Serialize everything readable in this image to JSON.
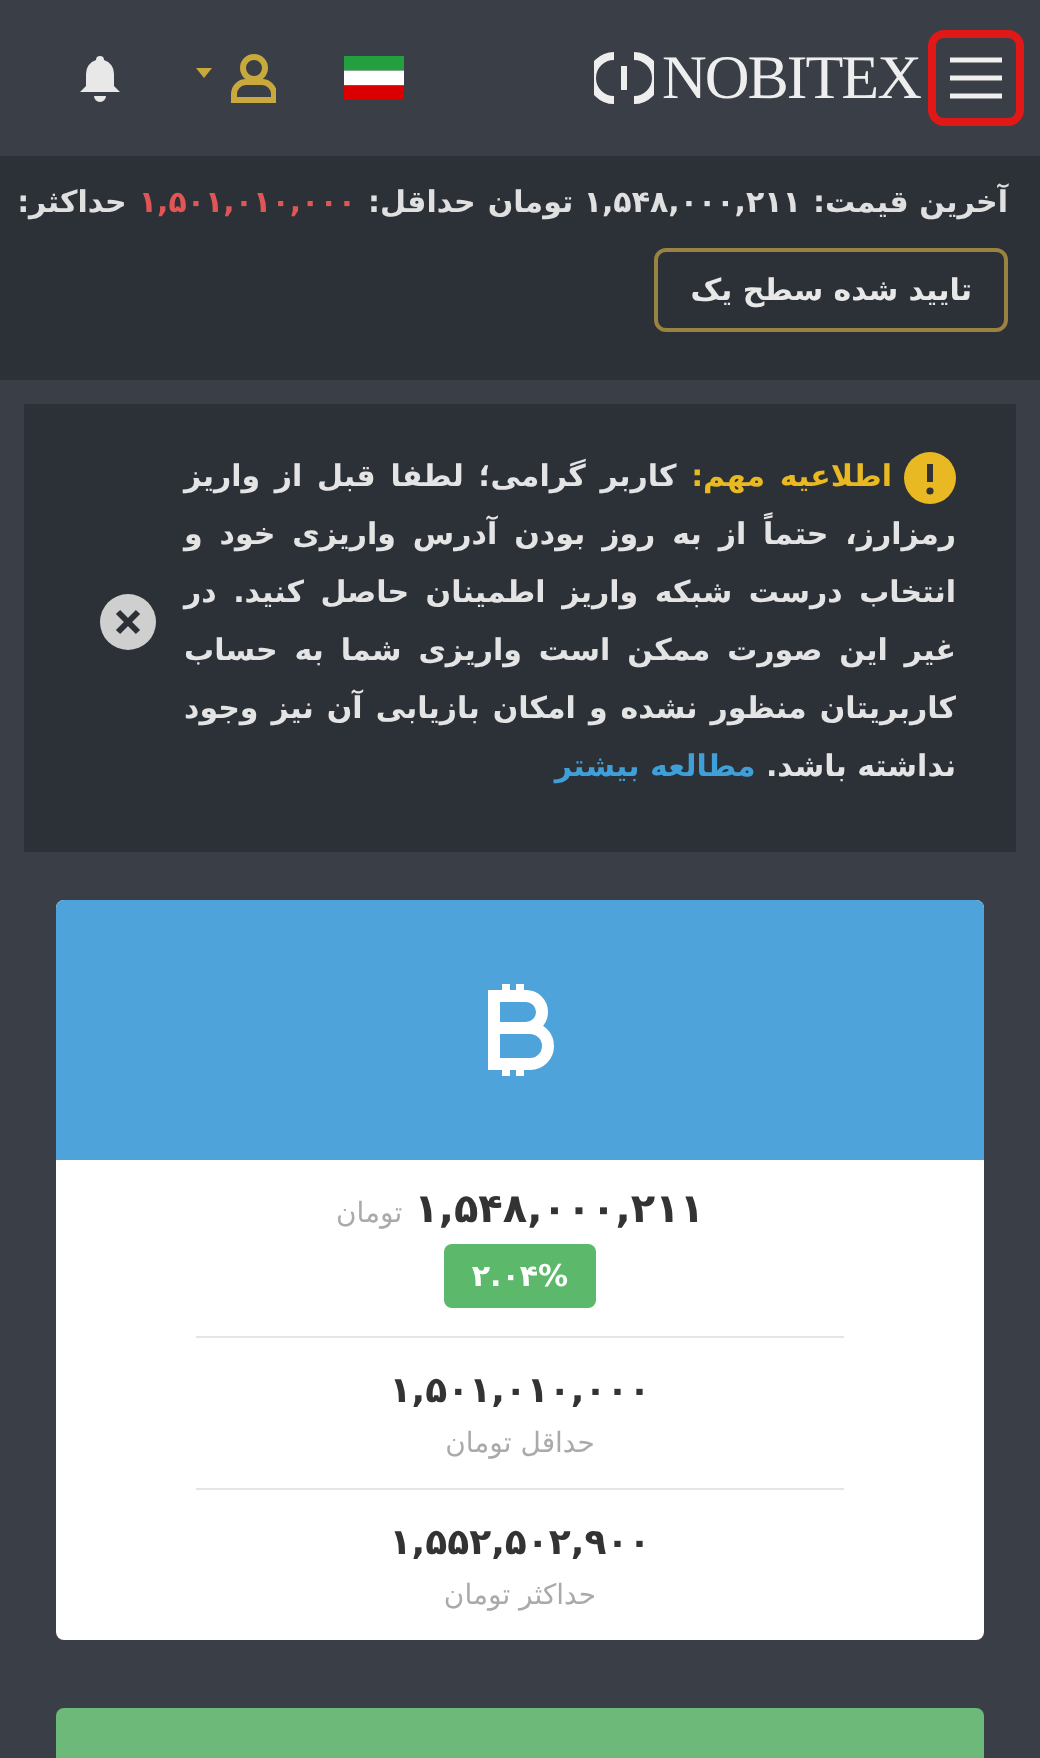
{
  "header": {
    "logo": "NOBITEX",
    "menu_highlighted": true
  },
  "ticker": {
    "items": [
      {
        "text": "آخرین قیمت:",
        "kind": "label"
      },
      {
        "text": "۱,۵۴۸,۰۰۰,۲۱۱ تومان",
        "kind": "value"
      },
      {
        "text": "حداقل:",
        "kind": "label"
      },
      {
        "text": "۱,۵۰۱,۰۱۰,۰۰۰",
        "kind": "low"
      },
      {
        "text": "حداکثر:",
        "kind": "label"
      }
    ],
    "level_badge": "تایید شده سطح یک"
  },
  "notice": {
    "title": "اطلاعیه مهم:",
    "body": "کاربر گرامی؛ لطفا قبل از واریز رمزارز، حتماً از به روز بودن آدرس واریزی خود و انتخاب درست شبکه واریز اطمینان حاصل کنید. در غیر این صورت ممکن است واریزی شما به حساب کاربریتان منظور نشده و امکان بازیابی آن نیز وجود نداشته باشد.",
    "link": "مطالعه بیشتر"
  },
  "market": {
    "price": "۱,۵۴۸,۰۰۰,۲۱۱",
    "currency": "تومان",
    "change": "۲.۰۴%",
    "change_positive": true,
    "stats": [
      {
        "value": "۱,۵۰۱,۰۱۰,۰۰۰",
        "label": "حداقل تومان"
      },
      {
        "value": "۱,۵۵۲,۵۰۲,۹۰۰",
        "label": "حداکثر تومان"
      }
    ]
  }
}
